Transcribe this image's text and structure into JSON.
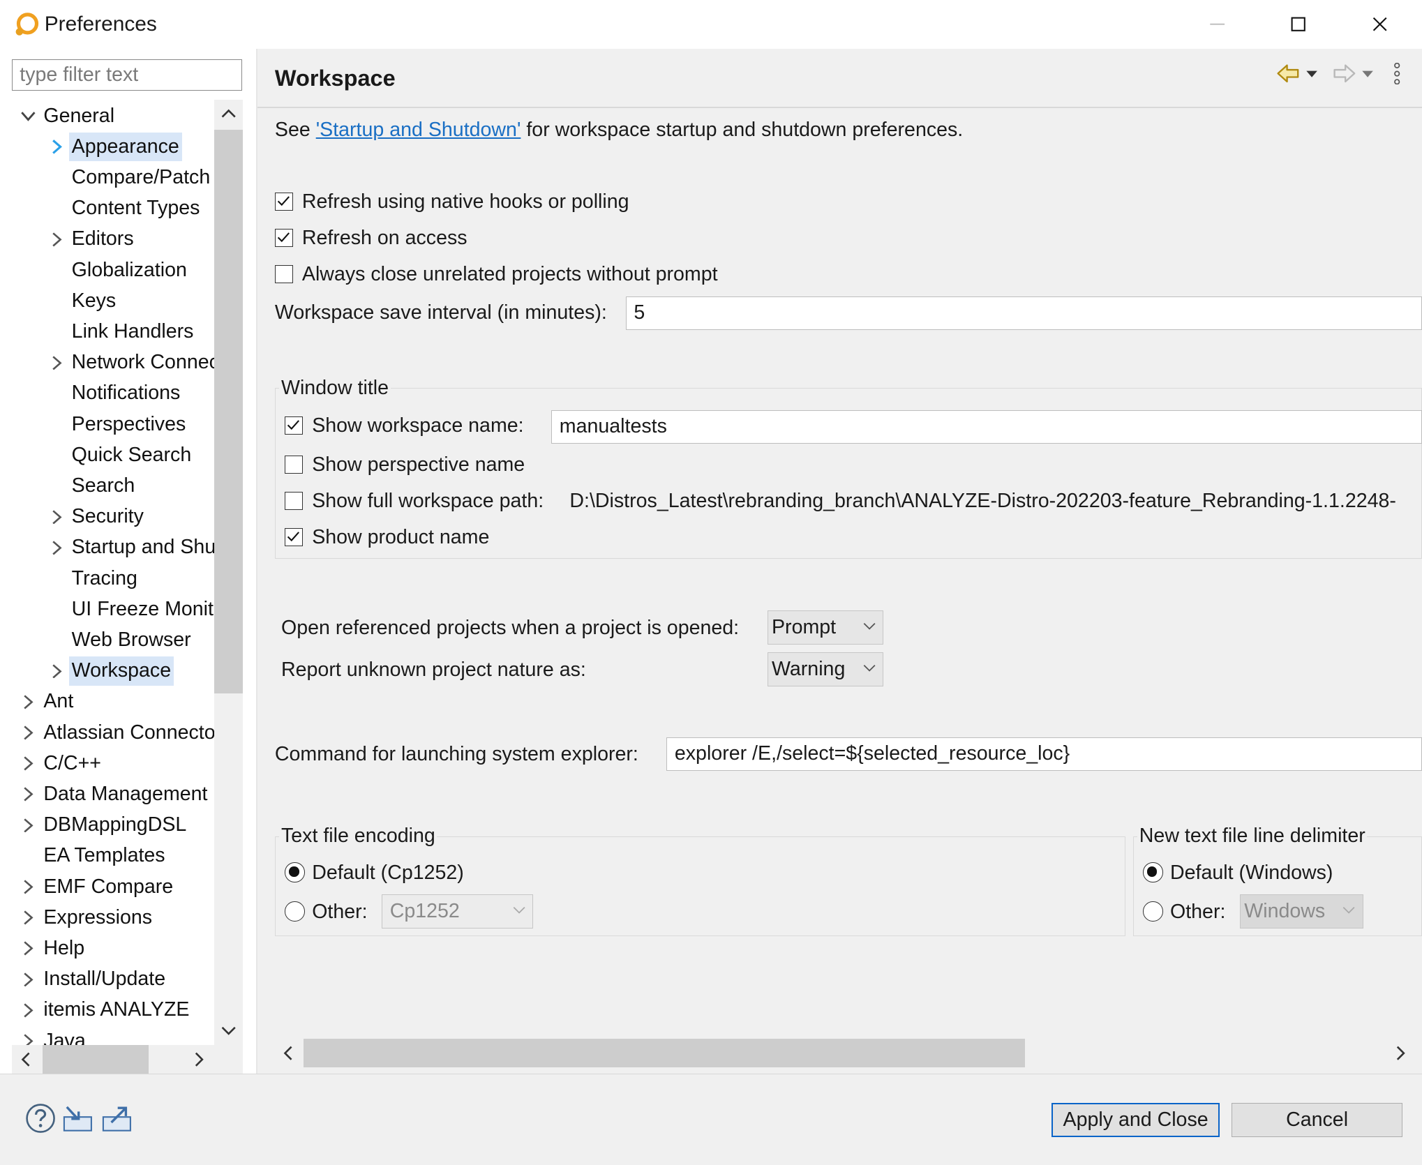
{
  "window": {
    "title": "Preferences"
  },
  "filter": {
    "placeholder": "type filter text"
  },
  "tree": {
    "general": "General",
    "general_children": {
      "appearance": "Appearance",
      "compare": "Compare/Patch",
      "content_types": "Content Types",
      "editors": "Editors",
      "globalization": "Globalization",
      "keys": "Keys",
      "link_handlers": "Link Handlers",
      "network": "Network Connections",
      "notifications": "Notifications",
      "perspectives": "Perspectives",
      "quick_search": "Quick Search",
      "search": "Search",
      "security": "Security",
      "startup": "Startup and Shutdown",
      "tracing": "Tracing",
      "ui_freeze": "UI Freeze Monitoring",
      "web_browser": "Web Browser",
      "workspace": "Workspace"
    },
    "top": {
      "ant": "Ant",
      "atlassian": "Atlassian Connector",
      "cpp": "C/C++",
      "data_mgmt": "Data Management",
      "dbmapping": "DBMappingDSL",
      "ea_templates": "EA Templates",
      "emf_compare": "EMF Compare",
      "expressions": "Expressions",
      "help": "Help",
      "install_update": "Install/Update",
      "itemis": "itemis ANALYZE",
      "java": "Java"
    }
  },
  "page": {
    "title": "Workspace",
    "intro_prefix": "See ",
    "intro_link": "'Startup and Shutdown'",
    "intro_suffix": " for workspace startup and shutdown preferences.",
    "refresh_native": {
      "label": "Refresh using native hooks or polling",
      "checked": true
    },
    "refresh_access": {
      "label": "Refresh on access",
      "checked": true
    },
    "always_close": {
      "label": "Always close unrelated projects without prompt",
      "checked": false
    },
    "save_interval": {
      "label": "Workspace save interval (in minutes):",
      "value": "5"
    },
    "window_title": {
      "group_label": "Window title",
      "show_ws_name": {
        "label": "Show workspace name:",
        "checked": true,
        "value": "manualtests"
      },
      "show_perspective": {
        "label": "Show perspective name",
        "checked": false
      },
      "show_full_path": {
        "label": "Show full workspace path:",
        "checked": false,
        "value": "D:\\Distros_Latest\\rebranding_branch\\ANALYZE-Distro-202203-feature_Rebranding-1.1.2248-"
      },
      "show_product": {
        "label": "Show product name",
        "checked": true
      }
    },
    "open_referenced": {
      "label": "Open referenced projects when a project is opened:",
      "value": "Prompt"
    },
    "unknown_nature": {
      "label": "Report unknown project nature as:",
      "value": "Warning"
    },
    "explorer_cmd": {
      "label": "Command for launching system explorer:",
      "value": "explorer /E,/select=${selected_resource_loc}"
    },
    "encoding": {
      "group_label": "Text file encoding",
      "default_label": "Default (Cp1252)",
      "other_label": "Other:",
      "other_value": "Cp1252"
    },
    "delimiter": {
      "group_label": "New text file line delimiter",
      "default_label": "Default (Windows)",
      "other_label": "Other:",
      "other_value": "Windows"
    }
  },
  "buttons": {
    "apply_close": "Apply and Close",
    "cancel": "Cancel"
  },
  "colors": {
    "accent": "#0a64c8",
    "link": "#1a6fc4",
    "selection": "#d8e6f7",
    "pane_bg": "#f0f0f0"
  }
}
